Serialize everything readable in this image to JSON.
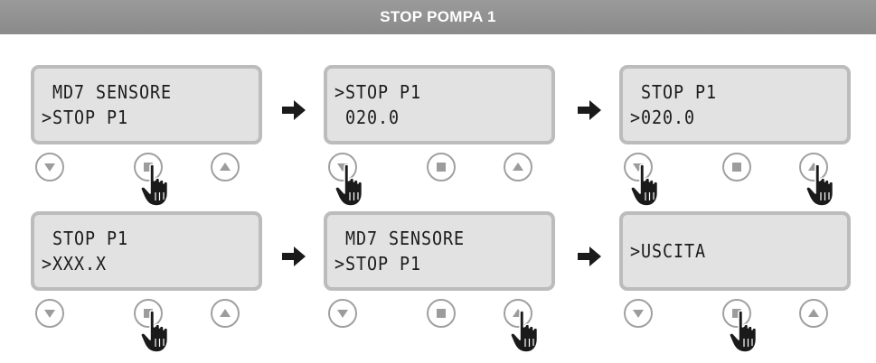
{
  "header": {
    "title": "STOP POMPA 1"
  },
  "icons": {
    "down": "triangle-down-icon",
    "stop": "square-stop-icon",
    "up": "triangle-up-icon",
    "press": "pointing-hand-icon",
    "next": "arrow-right-icon"
  },
  "colors": {
    "header": "#8f8f8f",
    "lcd_bg": "#e2e2e2",
    "lcd_frame": "#bcbcbc",
    "button": "#9c9c9c"
  },
  "panels": [
    {
      "line1": " MD7 SENSORE",
      "line2": ">STOP P1",
      "pressed": "stop"
    },
    {
      "line1": ">STOP P1",
      "line2": " 020.0",
      "pressed": "down"
    },
    {
      "line1": " STOP P1",
      "line2": ">020.0",
      "pressed": "down,up"
    },
    {
      "line1": " STOP P1",
      "line2": ">XXX.X",
      "pressed": "stop"
    },
    {
      "line1": " MD7 SENSORE",
      "line2": ">STOP P1",
      "pressed": "up"
    },
    {
      "line1": ">USCITA",
      "line2": "",
      "pressed": "stop"
    }
  ]
}
